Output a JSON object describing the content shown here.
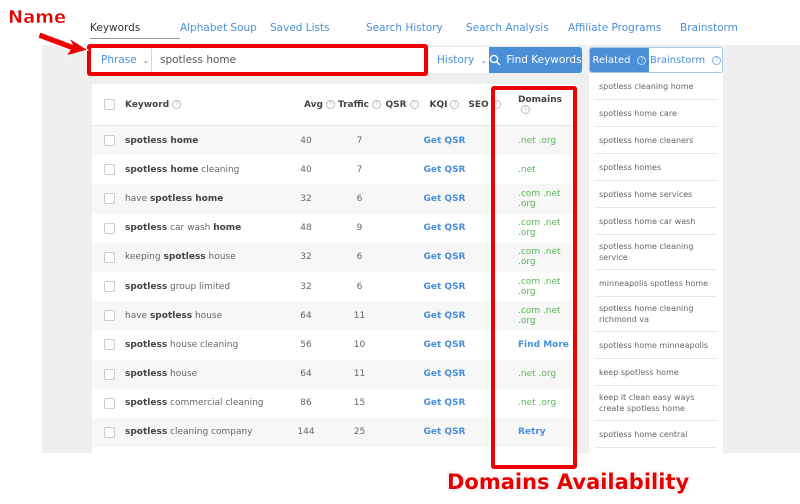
{
  "nav_tabs": [
    {
      "label": "Keywords",
      "active": true
    },
    {
      "label": "Alphabet Soup",
      "active": false
    },
    {
      "label": "Saved Lists",
      "active": false
    },
    {
      "label": "Search History",
      "active": false
    },
    {
      "label": "Search Analysis",
      "active": false
    },
    {
      "label": "Affiliate Programs",
      "active": false
    },
    {
      "label": "Brainstorm",
      "active": false
    }
  ],
  "search": {
    "mode": "Phrase",
    "query": "spotless home",
    "history_label": "History",
    "find_label": "Find Keywords",
    "search_icon": "search-icon",
    "accent_color": "#4a8fd8"
  },
  "table": {
    "headers": {
      "keyword": "Keyword",
      "avg": "Avg",
      "traffic": "Traffic",
      "qsr": "QSR",
      "kqi": "KQI",
      "seo": "SEO",
      "domains": "Domains"
    },
    "rows": [
      {
        "kw_parts": [
          {
            "t": "spotless home",
            "b": true
          }
        ],
        "avg": "40",
        "traffic": "7",
        "qsr": "Get QSR",
        "domains": ".net .org",
        "domains_type": "green"
      },
      {
        "kw_parts": [
          {
            "t": "spotless home",
            "b": true
          },
          {
            "t": " cleaning",
            "b": false
          }
        ],
        "avg": "40",
        "traffic": "7",
        "qsr": "Get QSR",
        "domains": ".net",
        "domains_type": "green"
      },
      {
        "kw_parts": [
          {
            "t": "have ",
            "b": false
          },
          {
            "t": "spotless home",
            "b": true
          }
        ],
        "avg": "32",
        "traffic": "6",
        "qsr": "Get QSR",
        "domains": ".com .net .org",
        "domains_type": "green"
      },
      {
        "kw_parts": [
          {
            "t": "spotless",
            "b": true
          },
          {
            "t": " car wash ",
            "b": false
          },
          {
            "t": "home",
            "b": true
          }
        ],
        "avg": "48",
        "traffic": "9",
        "qsr": "Get QSR",
        "domains": ".com .net .org",
        "domains_type": "green"
      },
      {
        "kw_parts": [
          {
            "t": "keeping ",
            "b": false
          },
          {
            "t": "spotless",
            "b": true
          },
          {
            "t": " house",
            "b": false
          }
        ],
        "avg": "32",
        "traffic": "6",
        "qsr": "Get QSR",
        "domains": ".com .net .org",
        "domains_type": "green"
      },
      {
        "kw_parts": [
          {
            "t": "spotless",
            "b": true
          },
          {
            "t": " group limited",
            "b": false
          }
        ],
        "avg": "32",
        "traffic": "6",
        "qsr": "Get QSR",
        "domains": ".com .net .org",
        "domains_type": "green"
      },
      {
        "kw_parts": [
          {
            "t": "have ",
            "b": false
          },
          {
            "t": "spotless",
            "b": true
          },
          {
            "t": " house",
            "b": false
          }
        ],
        "avg": "64",
        "traffic": "11",
        "qsr": "Get QSR",
        "domains": ".com .net .org",
        "domains_type": "green"
      },
      {
        "kw_parts": [
          {
            "t": "spotless",
            "b": true
          },
          {
            "t": " house cleaning",
            "b": false
          }
        ],
        "avg": "56",
        "traffic": "10",
        "qsr": "Get QSR",
        "domains": "Find More",
        "domains_type": "link"
      },
      {
        "kw_parts": [
          {
            "t": "spotless",
            "b": true
          },
          {
            "t": " house",
            "b": false
          }
        ],
        "avg": "64",
        "traffic": "11",
        "qsr": "Get QSR",
        "domains": ".net .org",
        "domains_type": "green"
      },
      {
        "kw_parts": [
          {
            "t": "spotless",
            "b": true
          },
          {
            "t": " commercial cleaning",
            "b": false
          }
        ],
        "avg": "86",
        "traffic": "15",
        "qsr": "Get QSR",
        "domains": ".net .org",
        "domains_type": "green"
      },
      {
        "kw_parts": [
          {
            "t": "spotless",
            "b": true
          },
          {
            "t": " cleaning company",
            "b": false
          }
        ],
        "avg": "144",
        "traffic": "25",
        "qsr": "Get QSR",
        "domains": "Retry",
        "domains_type": "link"
      }
    ]
  },
  "side_panel": {
    "tabs": [
      {
        "label": "Related",
        "active": true
      },
      {
        "label": "Brainstorm",
        "active": false
      }
    ],
    "items": [
      "spotless cleaning home",
      "spotless home care",
      "spotless home cleaners",
      "spotless homes",
      "spotless home services",
      "spotless home car wash",
      "spotless home cleaning service",
      "minneapolis spotless home",
      "spotless home cleaning richmond va",
      "spotless home minneapolis",
      "keep spotless home",
      "keep it clean easy ways create spotless home",
      "spotless home central"
    ]
  },
  "annotations": {
    "name_label": "Name",
    "domains_label": "Domains Availability",
    "color": "#ee0000"
  }
}
